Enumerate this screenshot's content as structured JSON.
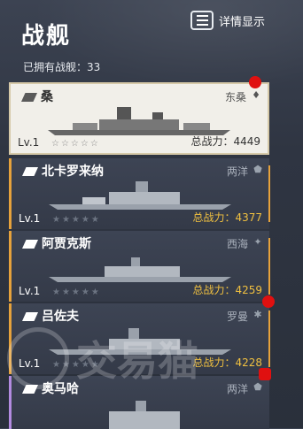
{
  "header": {
    "title": "战舰",
    "detail_label": "详情显示",
    "owned": "已拥有战舰：33"
  },
  "ships": [
    {
      "name": "桑",
      "nation": "东桑",
      "nation_icon": "bell-icon",
      "level": "Lv.1",
      "stars": "☆☆☆☆☆",
      "power": "总战力：4449",
      "selected": true
    },
    {
      "name": "北卡罗来纳",
      "nation": "两洋",
      "nation_icon": "shield-icon",
      "level": "Lv.1",
      "stars": "★★★★★",
      "power": "总战力：4377"
    },
    {
      "name": "阿贾克斯",
      "nation": "西海",
      "nation_icon": "emblem-icon",
      "level": "Lv.1",
      "stars": "★★★★★",
      "power": "总战力：4259"
    },
    {
      "name": "吕佐夫",
      "nation": "罗曼",
      "nation_icon": "cross-icon",
      "level": "Lv.1",
      "stars": "★★★★★",
      "power": "总战力：4228"
    },
    {
      "name": "奥马哈",
      "nation": "两洋",
      "nation_icon": "shield-icon"
    }
  ],
  "watermark": "交易猫",
  "colors": {
    "accent": "#e6a23c",
    "badge": "#e01010",
    "power": "#f0c040"
  }
}
